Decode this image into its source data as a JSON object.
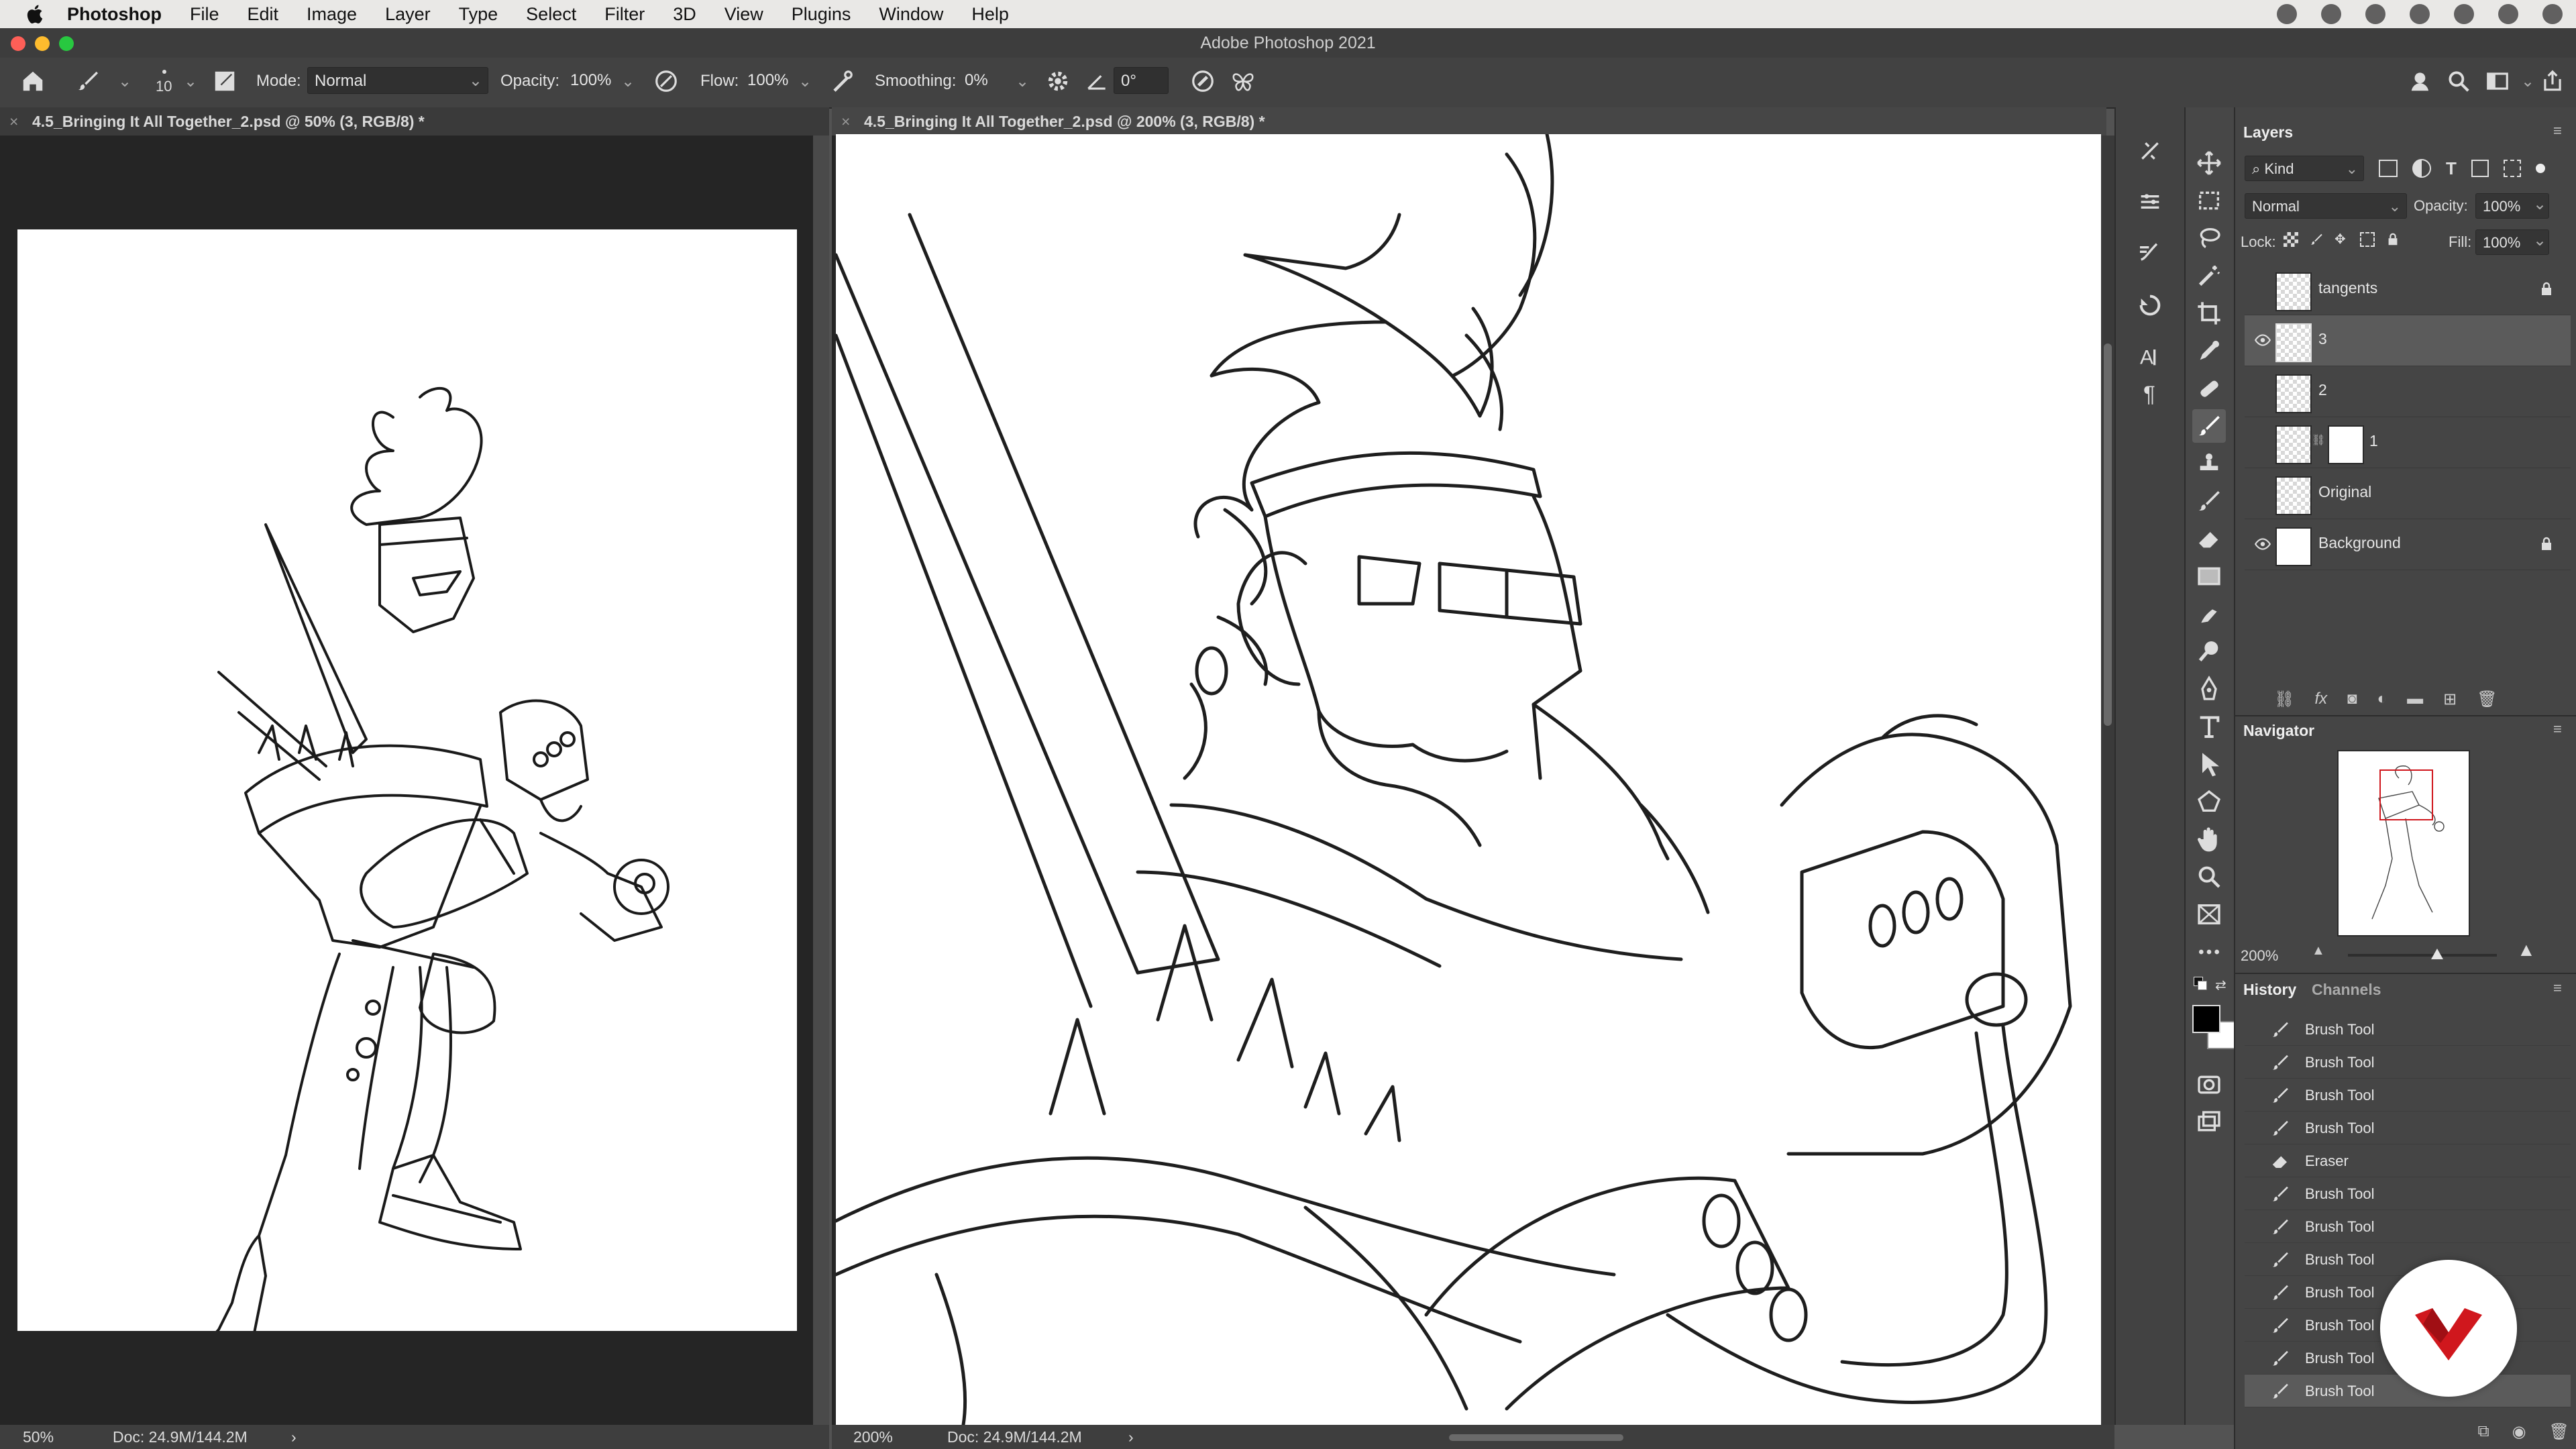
{
  "menubar": {
    "app_name": "Photoshop",
    "items": [
      "File",
      "Edit",
      "Image",
      "Layer",
      "Type",
      "Select",
      "Filter",
      "3D",
      "View",
      "Plugins",
      "Window",
      "Help"
    ]
  },
  "window": {
    "title": "Adobe Photoshop 2021"
  },
  "options": {
    "brush_size": "10",
    "mode_label": "Mode:",
    "mode_value": "Normal",
    "opacity_label": "Opacity:",
    "opacity_value": "100%",
    "flow_label": "Flow:",
    "flow_value": "100%",
    "smoothing_label": "Smoothing:",
    "smoothing_value": "0%",
    "angle_value": "0°"
  },
  "documents": [
    {
      "tab": "4.5_Bringing It All Together_2.psd @ 50% (3, RGB/8) *",
      "zoom": "50%",
      "doc_size": "Doc: 24.9M/144.2M"
    },
    {
      "tab": "4.5_Bringing It All Together_2.psd @ 200% (3, RGB/8) *",
      "zoom": "200%",
      "doc_size": "Doc: 24.9M/144.2M"
    }
  ],
  "layers_panel": {
    "title": "Layers",
    "filter": "Kind",
    "blend_mode": "Normal",
    "opacity_label": "Opacity:",
    "opacity_value": "100%",
    "lock_label": "Lock:",
    "fill_label": "Fill:",
    "fill_value": "100%",
    "layers": [
      {
        "name": "tangents",
        "visible": false,
        "locked": true,
        "selected": false
      },
      {
        "name": "3",
        "visible": true,
        "locked": false,
        "selected": true
      },
      {
        "name": "2",
        "visible": false,
        "locked": false,
        "selected": false
      },
      {
        "name": "1",
        "visible": false,
        "locked": false,
        "selected": false
      },
      {
        "name": "Original",
        "visible": false,
        "locked": false,
        "selected": false
      },
      {
        "name": "Background",
        "visible": true,
        "locked": true,
        "selected": false
      }
    ]
  },
  "navigator": {
    "title": "Navigator",
    "zoom": "200%"
  },
  "history_panel": {
    "title": "History",
    "tab2": "Channels",
    "steps": [
      "Brush Tool",
      "Brush Tool",
      "Brush Tool",
      "Brush Tool",
      "Eraser",
      "Brush Tool",
      "Brush Tool",
      "Brush Tool",
      "Brush Tool",
      "Brush Tool",
      "Brush Tool",
      "Brush Tool"
    ]
  },
  "colors": {
    "foreground": "#000000",
    "background": "#ffffff",
    "brand_logo": "#d0171d"
  }
}
